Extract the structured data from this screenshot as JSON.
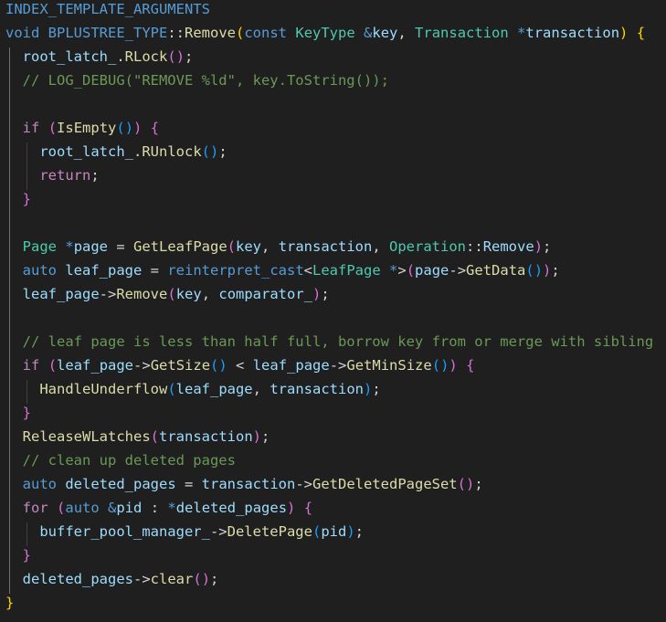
{
  "editor": {
    "lines": [
      [
        [
          "INDEX_TEMPLATE_ARGUMENTS",
          "macro"
        ]
      ],
      [
        [
          "void",
          "kw"
        ],
        [
          " ",
          "op"
        ],
        [
          "BPLUSTREE_TYPE",
          "macro"
        ],
        [
          "::",
          "op"
        ],
        [
          "Remove",
          "fn"
        ],
        [
          "(",
          "br1"
        ],
        [
          "const",
          "kw"
        ],
        [
          " ",
          "op"
        ],
        [
          "KeyType",
          "type"
        ],
        [
          " ",
          "op"
        ],
        [
          "&",
          "kw"
        ],
        [
          "key",
          "var"
        ],
        [
          ", ",
          "op"
        ],
        [
          "Transaction",
          "type"
        ],
        [
          " ",
          "op"
        ],
        [
          "*",
          "kw"
        ],
        [
          "transaction",
          "var"
        ],
        [
          ")",
          "br1"
        ],
        [
          " ",
          "op"
        ],
        [
          "{",
          "br1"
        ]
      ],
      [
        [
          "  ",
          "op"
        ],
        [
          "root_latch_",
          "var"
        ],
        [
          ".",
          "op"
        ],
        [
          "RLock",
          "fn"
        ],
        [
          "(",
          "br2"
        ],
        [
          ")",
          "br2"
        ],
        [
          ";",
          "op"
        ]
      ],
      [
        [
          "  ",
          "op"
        ],
        [
          "// LOG_DEBUG(\"REMOVE %ld\", key.ToString());",
          "cmt"
        ]
      ],
      [],
      [
        [
          "  ",
          "op"
        ],
        [
          "if",
          "ctrl"
        ],
        [
          " ",
          "op"
        ],
        [
          "(",
          "br2"
        ],
        [
          "IsEmpty",
          "fn"
        ],
        [
          "(",
          "br3"
        ],
        [
          ")",
          "br3"
        ],
        [
          ")",
          "br2"
        ],
        [
          " ",
          "op"
        ],
        [
          "{",
          "br2"
        ]
      ],
      [
        [
          "    ",
          "op"
        ],
        [
          "root_latch_",
          "var"
        ],
        [
          ".",
          "op"
        ],
        [
          "RUnlock",
          "fn"
        ],
        [
          "(",
          "br3"
        ],
        [
          ")",
          "br3"
        ],
        [
          ";",
          "op"
        ]
      ],
      [
        [
          "    ",
          "op"
        ],
        [
          "return",
          "ctrl"
        ],
        [
          ";",
          "op"
        ]
      ],
      [
        [
          "  ",
          "op"
        ],
        [
          "}",
          "br2"
        ]
      ],
      [],
      [
        [
          "  ",
          "op"
        ],
        [
          "Page",
          "type"
        ],
        [
          " ",
          "op"
        ],
        [
          "*",
          "kw"
        ],
        [
          "page",
          "var"
        ],
        [
          " = ",
          "op"
        ],
        [
          "GetLeafPage",
          "fn"
        ],
        [
          "(",
          "br2"
        ],
        [
          "key",
          "var"
        ],
        [
          ", ",
          "op"
        ],
        [
          "transaction",
          "var"
        ],
        [
          ", ",
          "op"
        ],
        [
          "Operation",
          "type"
        ],
        [
          "::",
          "op"
        ],
        [
          "Remove",
          "var"
        ],
        [
          ")",
          "br2"
        ],
        [
          ";",
          "op"
        ]
      ],
      [
        [
          "  ",
          "op"
        ],
        [
          "auto",
          "kw"
        ],
        [
          " ",
          "op"
        ],
        [
          "leaf_page",
          "var"
        ],
        [
          " = ",
          "op"
        ],
        [
          "reinterpret_cast",
          "kw"
        ],
        [
          "<",
          "op"
        ],
        [
          "LeafPage",
          "type"
        ],
        [
          " ",
          "op"
        ],
        [
          "*",
          "kw"
        ],
        [
          ">",
          "op"
        ],
        [
          "(",
          "br2"
        ],
        [
          "page",
          "var"
        ],
        [
          "->",
          "op"
        ],
        [
          "GetData",
          "fn"
        ],
        [
          "(",
          "br3"
        ],
        [
          ")",
          "br3"
        ],
        [
          ")",
          "br2"
        ],
        [
          ";",
          "op"
        ]
      ],
      [
        [
          "  ",
          "op"
        ],
        [
          "leaf_page",
          "var"
        ],
        [
          "->",
          "op"
        ],
        [
          "Remove",
          "fn"
        ],
        [
          "(",
          "br2"
        ],
        [
          "key",
          "var"
        ],
        [
          ", ",
          "op"
        ],
        [
          "comparator_",
          "var"
        ],
        [
          ")",
          "br2"
        ],
        [
          ";",
          "op"
        ]
      ],
      [],
      [
        [
          "  ",
          "op"
        ],
        [
          "// leaf page is less than half full, borrow key from or merge with sibling",
          "cmt"
        ]
      ],
      [
        [
          "  ",
          "op"
        ],
        [
          "if",
          "ctrl"
        ],
        [
          " ",
          "op"
        ],
        [
          "(",
          "br2"
        ],
        [
          "leaf_page",
          "var"
        ],
        [
          "->",
          "op"
        ],
        [
          "GetSize",
          "fn"
        ],
        [
          "(",
          "br3"
        ],
        [
          ")",
          "br3"
        ],
        [
          " < ",
          "op"
        ],
        [
          "leaf_page",
          "var"
        ],
        [
          "->",
          "op"
        ],
        [
          "GetMinSize",
          "fn"
        ],
        [
          "(",
          "br3"
        ],
        [
          ")",
          "br3"
        ],
        [
          ")",
          "br2"
        ],
        [
          " ",
          "op"
        ],
        [
          "{",
          "br2"
        ]
      ],
      [
        [
          "    ",
          "op"
        ],
        [
          "HandleUnderflow",
          "fn"
        ],
        [
          "(",
          "br3"
        ],
        [
          "leaf_page",
          "var"
        ],
        [
          ", ",
          "op"
        ],
        [
          "transaction",
          "var"
        ],
        [
          ")",
          "br3"
        ],
        [
          ";",
          "op"
        ]
      ],
      [
        [
          "  ",
          "op"
        ],
        [
          "}",
          "br2"
        ]
      ],
      [
        [
          "  ",
          "op"
        ],
        [
          "ReleaseWLatches",
          "fn"
        ],
        [
          "(",
          "br2"
        ],
        [
          "transaction",
          "var"
        ],
        [
          ")",
          "br2"
        ],
        [
          ";",
          "op"
        ]
      ],
      [
        [
          "  ",
          "op"
        ],
        [
          "// clean up deleted pages",
          "cmt"
        ]
      ],
      [
        [
          "  ",
          "op"
        ],
        [
          "auto",
          "kw"
        ],
        [
          " ",
          "op"
        ],
        [
          "deleted_pages",
          "var"
        ],
        [
          " = ",
          "op"
        ],
        [
          "transaction",
          "var"
        ],
        [
          "->",
          "op"
        ],
        [
          "GetDeletedPageSet",
          "fn"
        ],
        [
          "(",
          "br2"
        ],
        [
          ")",
          "br2"
        ],
        [
          ";",
          "op"
        ]
      ],
      [
        [
          "  ",
          "op"
        ],
        [
          "for",
          "ctrl"
        ],
        [
          " ",
          "op"
        ],
        [
          "(",
          "br2"
        ],
        [
          "auto",
          "kw"
        ],
        [
          " ",
          "op"
        ],
        [
          "&",
          "kw"
        ],
        [
          "pid",
          "var"
        ],
        [
          " : ",
          "op"
        ],
        [
          "*",
          "kw"
        ],
        [
          "deleted_pages",
          "var"
        ],
        [
          ")",
          "br2"
        ],
        [
          " ",
          "op"
        ],
        [
          "{",
          "br2"
        ]
      ],
      [
        [
          "    ",
          "op"
        ],
        [
          "buffer_pool_manager_",
          "var"
        ],
        [
          "->",
          "op"
        ],
        [
          "DeletePage",
          "fn"
        ],
        [
          "(",
          "br3"
        ],
        [
          "pid",
          "var"
        ],
        [
          ")",
          "br3"
        ],
        [
          ";",
          "op"
        ]
      ],
      [
        [
          "  ",
          "op"
        ],
        [
          "}",
          "br2"
        ]
      ],
      [
        [
          "  ",
          "op"
        ],
        [
          "deleted_pages",
          "var"
        ],
        [
          "->",
          "op"
        ],
        [
          "clear",
          "fn"
        ],
        [
          "(",
          "br2"
        ],
        [
          ")",
          "br2"
        ],
        [
          ";",
          "op"
        ]
      ],
      [
        [
          "}",
          "br1"
        ]
      ]
    ]
  },
  "colors": {
    "background": "#1f1f1f",
    "keyword": "#569cd6",
    "control": "#c586c0",
    "type": "#4ec9b0",
    "function": "#dcdcaa",
    "variable": "#9cdcfe",
    "comment": "#6a9955",
    "bracket_level1": "#ffd700",
    "bracket_level2": "#da70d6",
    "bracket_level3": "#179fff"
  }
}
